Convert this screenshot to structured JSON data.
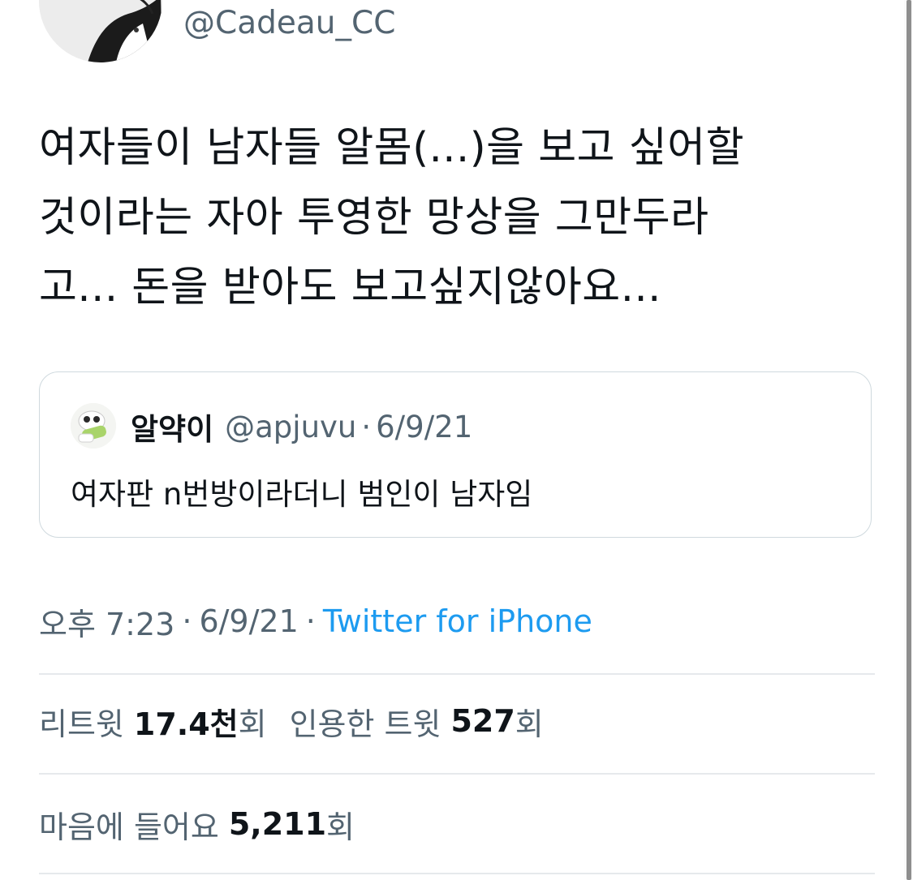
{
  "author": {
    "handle": "@Cadeau_CC"
  },
  "tweet": {
    "lines": [
      "여자들이 남자들 알몸(...)을 보고 싶어할",
      "것이라는 자아 투영한 망상을 그만두라",
      "고... 돈을 받아도 보고싶지않아요..."
    ]
  },
  "quote": {
    "name": "알약이",
    "handle": "@apjuvu",
    "separator": "·",
    "date": "6/9/21",
    "text": "여자판 n번방이라더니 범인이 남자임"
  },
  "meta": {
    "time": "오후 7:23",
    "separator": "·",
    "date": "6/9/21",
    "source": "Twitter for iPhone"
  },
  "stats": {
    "retweets_label": "리트윗",
    "retweets_value": "17.4천",
    "retweets_unit": "회",
    "quotes_label": "인용한 트윗",
    "quotes_value": "527",
    "quotes_unit": "회",
    "likes_label": "마음에 들어요",
    "likes_value": "5,211",
    "likes_unit": "회"
  },
  "colors": {
    "text": "#0f1419",
    "secondary": "#536471",
    "link": "#1d9bf0",
    "border": "#cfd9de",
    "divider": "#e6e9ec"
  }
}
